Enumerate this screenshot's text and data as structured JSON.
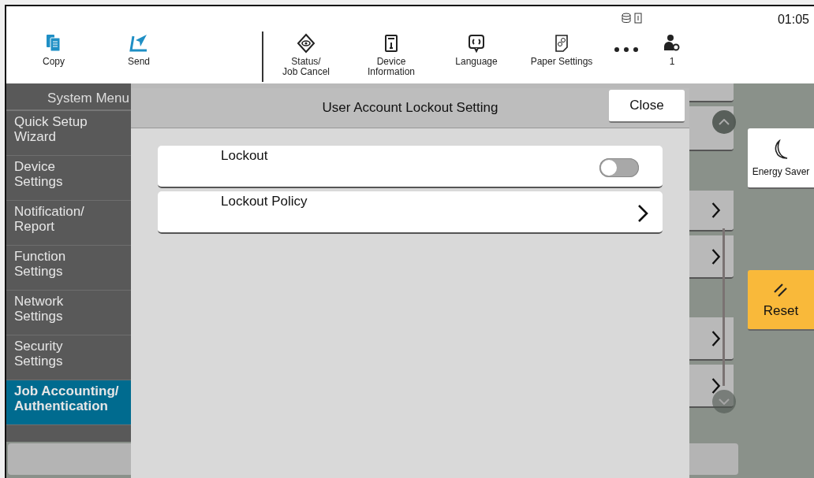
{
  "top_bar": {
    "apps": [
      {
        "kind": "copy",
        "label": "Copy"
      },
      {
        "kind": "send",
        "label": "Send"
      }
    ],
    "tools": [
      {
        "kind": "status",
        "label": "Status/\nJob Cancel"
      },
      {
        "kind": "info",
        "label": "Device\nInformation"
      },
      {
        "kind": "language",
        "label": "Language"
      },
      {
        "kind": "paper",
        "label": "Paper Settings"
      },
      {
        "kind": "more"
      },
      {
        "kind": "user",
        "label": "1"
      }
    ],
    "time": "01:05"
  },
  "sidebar": {
    "title": "System Menu",
    "items": [
      {
        "label": "Quick Setup\nWizard",
        "selected": false
      },
      {
        "label": "Device\nSettings",
        "selected": false
      },
      {
        "label": "Notification/\nReport",
        "selected": false
      },
      {
        "label": "Function\nSettings",
        "selected": false
      },
      {
        "label": "Network\nSettings",
        "selected": false
      },
      {
        "label": "Security\nSettings",
        "selected": false
      },
      {
        "label": "Job Accounting/\nAuthentication",
        "selected": true
      }
    ]
  },
  "dialog": {
    "title": "User Account Lockout Setting",
    "close_button": "Close",
    "rows": [
      {
        "kind": "toggle",
        "label": "Lockout",
        "on": false
      },
      {
        "kind": "link",
        "label": "Lockout Policy"
      }
    ]
  },
  "side_buttons": [
    {
      "kind": "energy",
      "label": "Energy Saver"
    },
    {
      "kind": "reset",
      "label": "Reset"
    }
  ]
}
